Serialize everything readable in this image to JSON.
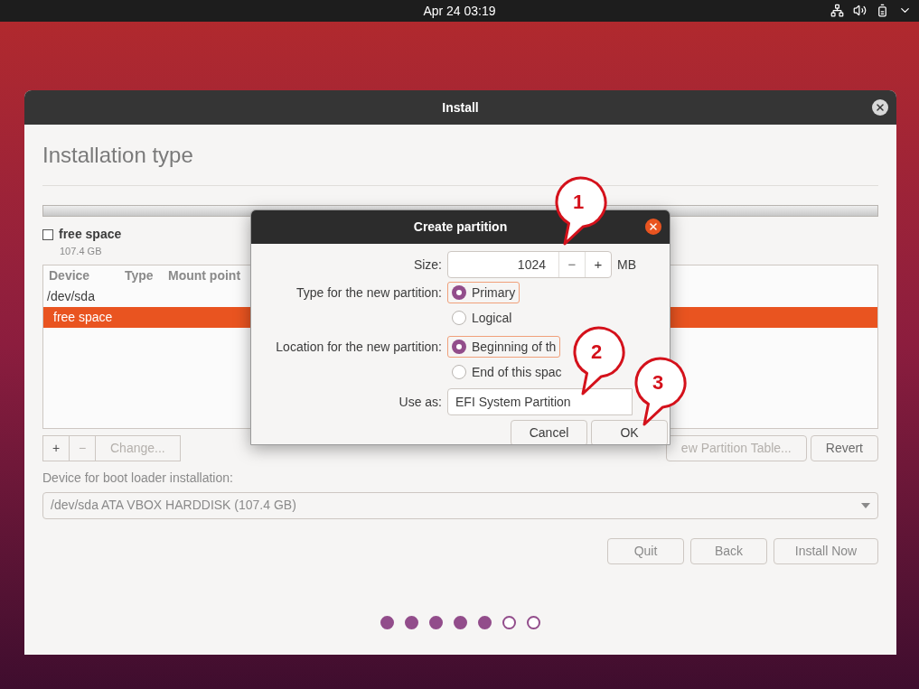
{
  "top_bar": {
    "clock": "Apr 24  03:19"
  },
  "window": {
    "title": "Install",
    "heading": "Installation type"
  },
  "partition_legend": [
    {
      "label": "free space",
      "size": "107.4 GB",
      "checked": false
    }
  ],
  "table": {
    "columns": [
      "Device",
      "Type",
      "Mount point"
    ],
    "rows": [
      {
        "cells": [
          "/dev/sda"
        ],
        "selected": false,
        "children": [
          {
            "cells": [
              "free space"
            ],
            "selected": true
          }
        ]
      }
    ]
  },
  "table_buttons": [
    {
      "label": "+",
      "disabled": false
    },
    {
      "label": "−",
      "disabled": true
    },
    {
      "label": "Change...",
      "disabled": true
    }
  ],
  "partition_table_buttons": [
    {
      "label": "ew Partition Table...",
      "disabled": true
    },
    {
      "label": "Revert",
      "disabled": false
    }
  ],
  "boot_loader": {
    "label": "Device for boot loader installation:",
    "value": "/dev/sda ATA VBOX HARDDISK (107.4 GB)"
  },
  "nav_buttons": [
    {
      "label": "Quit"
    },
    {
      "label": "Back"
    },
    {
      "label": "Install Now"
    }
  ],
  "progress_dots": [
    {
      "filled": true
    },
    {
      "filled": true
    },
    {
      "filled": true
    },
    {
      "filled": true
    },
    {
      "filled": true
    },
    {
      "filled": false
    },
    {
      "filled": false
    }
  ],
  "dialog": {
    "title": "Create partition",
    "size_label": "Size:",
    "size_value": "1024",
    "minus": "−",
    "plus": "+",
    "unit": "MB",
    "type_label": "Type for the new partition:",
    "type_options": [
      {
        "label": "Primary",
        "selected": true
      },
      {
        "label": "Logical",
        "selected": false
      }
    ],
    "location_label": "Location for the new partition:",
    "location_options": [
      {
        "label": "Beginning of th",
        "selected": true
      },
      {
        "label": "End of this spac",
        "selected": false
      }
    ],
    "use_as_label": "Use as:",
    "use_as_value": "EFI System Partition",
    "buttons": [
      {
        "label": "Cancel"
      },
      {
        "label": "OK"
      }
    ]
  },
  "callouts": [
    {
      "number": "1"
    },
    {
      "number": "2"
    },
    {
      "number": "3"
    }
  ]
}
